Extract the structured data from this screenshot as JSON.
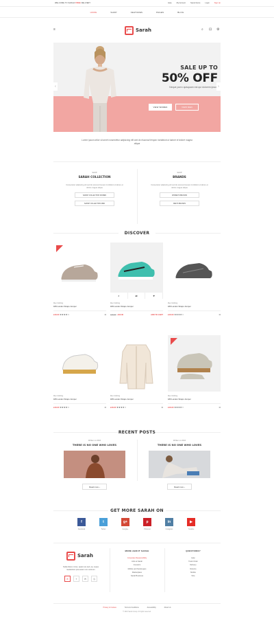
{
  "topbar": {
    "promo_prefix": "WELCOME TO SARAH!",
    "promo_highlight": "FREE",
    "promo_suffix": "DELIVERY",
    "links": [
      "Help",
      "My Account",
      "Saved Items",
      "Login",
      "Sign Up"
    ]
  },
  "nav": {
    "items": [
      "HOME",
      "SHOP",
      "FEATURES",
      "PAGES",
      "BLOG"
    ]
  },
  "logo": {
    "text": "Sarah"
  },
  "hero": {
    "line1": "SALE UP TO",
    "line2": "50% OFF",
    "line3": "Neque porro quisquam est qui dolorem ipsum",
    "btn_women": "VIEW WOMEN",
    "btn_men": "VIEW MEN"
  },
  "intro": "Lorem ipsum dolor sit amet consectetur adipiscing elit sed do eiusmod tempor incididunt ut labore et dolore magna aliqua",
  "shop": [
    {
      "small": "SHOP",
      "title": "SARAH COLLECTION",
      "desc": "Consectetur adipiscing elit sed do eiusmod tempor incididunt ut labore et dolore magna aliqua",
      "buttons": [
        "SARAH COLLECTION WOMEN",
        "SARAH COLLECTION MEN"
      ]
    },
    {
      "small": "SHOP",
      "title": "BRANDS",
      "desc": "Consectetur adipiscing elit sed do eiusmod tempor incididunt ut labore et dolore magna aliqua",
      "buttons": [
        "WOMEN'S BRANDS",
        "MEN'S BRANDS"
      ]
    }
  ],
  "discover": {
    "title": "DISCOVER",
    "products": [
      {
        "cat": "Men Clothing",
        "name": "189 London Straps Jumper",
        "price": "£16.00",
        "old": "",
        "cart": "",
        "badge": true
      },
      {
        "cat": "Men Clothing",
        "name": "189 London Straps Jumper",
        "price": "£16.00",
        "old": "£16.00",
        "cart": "ADD TO CART",
        "badge": false
      },
      {
        "cat": "Men Clothing",
        "name": "189 London Straps Jumper",
        "price": "£16.00",
        "old": "",
        "cart": "",
        "badge": false
      },
      {
        "cat": "Men Clothing",
        "name": "189 London Straps Jumper",
        "price": "£16.00",
        "old": "",
        "cart": "",
        "badge": false
      },
      {
        "cat": "Men Clothing",
        "name": "189 London Straps Jumper",
        "price": "£16.00",
        "old": "",
        "cart": "",
        "badge": false
      },
      {
        "cat": "Men Clothing",
        "name": "189 London Straps Jumper",
        "price": "£16.00",
        "old": "",
        "cart": "",
        "badge": true
      }
    ],
    "stars": "★★★★☆"
  },
  "posts": {
    "title": "RECENT POSTS",
    "items": [
      {
        "date": "Written on 2016",
        "title": "THERE IS NO ONE WHO LOVES",
        "more": "Read more"
      },
      {
        "date": "Written on 2016",
        "title": "THERE IS NO ONE WHO LOVES",
        "more": "Read more"
      }
    ]
  },
  "social": {
    "title": "GET MORE SARAH ON",
    "items": [
      {
        "label": "Facebook",
        "glyph": "f",
        "color": "#3b5998"
      },
      {
        "label": "Twitter",
        "glyph": "t",
        "color": "#4a9fd8"
      },
      {
        "label": "Google+",
        "glyph": "g+",
        "color": "#d34836"
      },
      {
        "label": "Pinterest",
        "glyph": "p",
        "color": "#cb2027"
      },
      {
        "label": "Instagram",
        "glyph": "in",
        "color": "#517fa4"
      },
      {
        "label": "Youtube",
        "glyph": "▶",
        "color": "#e52d27"
      }
    ]
  },
  "footer": {
    "about": "Nulla dolore minus, quasi iure sed, ea, neque laudantium ipsa autem non nostrum",
    "col1_title": "MORE ABOUT SARAH",
    "col1_items": [
      "Corporate Responsibility",
      "Jobs at Sarah",
      "Investors",
      "Mobile and Social apps",
      "Marketplace",
      "Sarah Business"
    ],
    "col2_title": "QUESTIONS?",
    "col2_items": [
      "Help",
      "Track Order",
      "Delivery",
      "Returns",
      "Mobile",
      "Size"
    ],
    "bottom_links": [
      "Privacy & Cookies",
      "Terms & Conditions",
      "Accessibility",
      "About Us"
    ],
    "copyright": "© 2016 Sarah Group. All rights reserved."
  },
  "colors": {
    "accent": "#e94b4b",
    "hero_band": "#f2a6a2"
  }
}
